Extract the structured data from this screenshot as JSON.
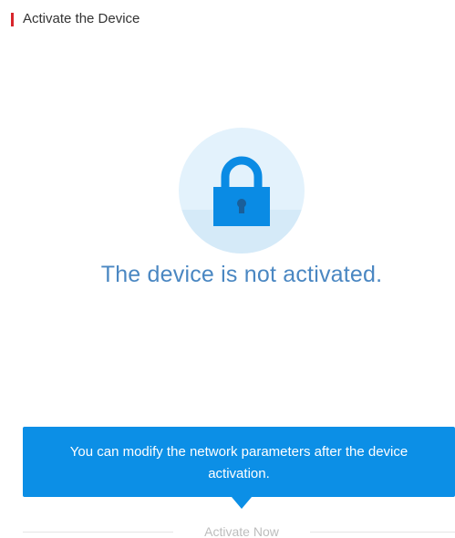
{
  "header": {
    "title": "Activate the Device",
    "accent_color": "#d8252c"
  },
  "status": {
    "icon": "lock-icon",
    "message": "The device is not activated.",
    "message_color": "#4a87c2"
  },
  "tooltip": {
    "text": "You can modify the network parameters after the device activation.",
    "background_color": "#0c8fe6"
  },
  "actions": {
    "activate_label": "Activate Now"
  }
}
